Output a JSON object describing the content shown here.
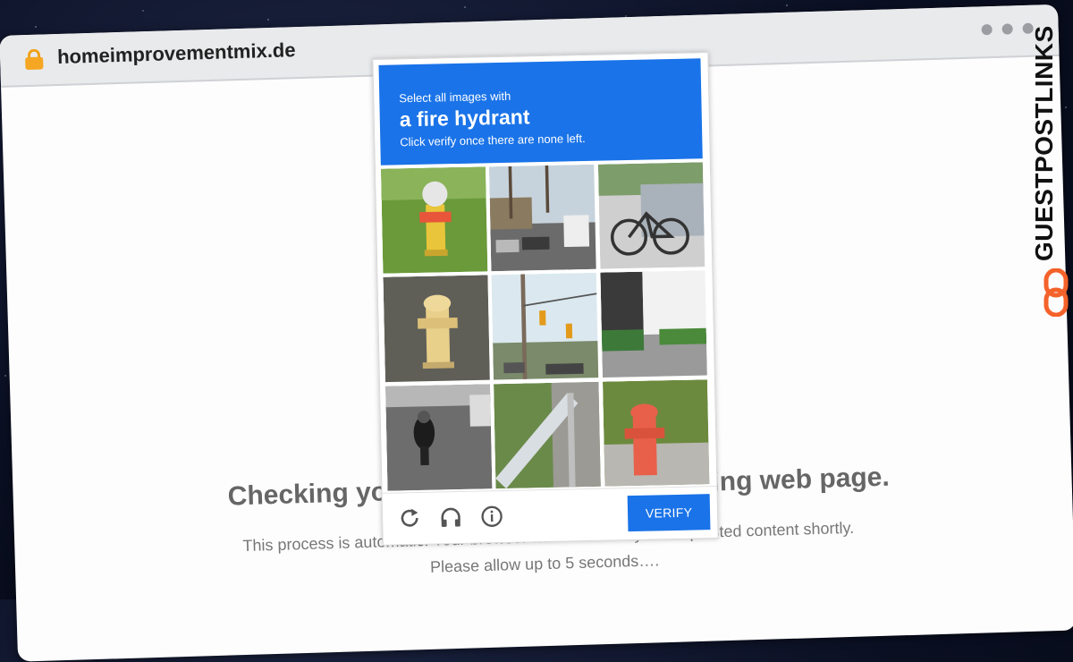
{
  "browser": {
    "url": "homeimprovementmix.de"
  },
  "page": {
    "heading": "Checking your browser before accessing web page.",
    "paragraph": "This process is automatic. Your browser will redirect to your requested content shortly.",
    "wait_text": "Please allow up to 5 seconds…."
  },
  "captcha": {
    "instruction": "Select all images with",
    "target": "a fire hydrant",
    "hint": "Click verify once there are none left.",
    "tiles": [
      {
        "subject": "fire-hydrant"
      },
      {
        "subject": "street-traffic"
      },
      {
        "subject": "bicycle"
      },
      {
        "subject": "fire-hydrant"
      },
      {
        "subject": "traffic-light"
      },
      {
        "subject": "building-entrance"
      },
      {
        "subject": "motorcycle"
      },
      {
        "subject": "stairs"
      },
      {
        "subject": "fire-hydrant"
      }
    ],
    "footer_icons": [
      "reload-icon",
      "headphones-icon",
      "info-icon"
    ],
    "verify_label": "VERIFY",
    "accent_color": "#1a73e8"
  },
  "branding": {
    "name": "GUESTPOSTLINKS",
    "accent_color": "#f4622a"
  }
}
